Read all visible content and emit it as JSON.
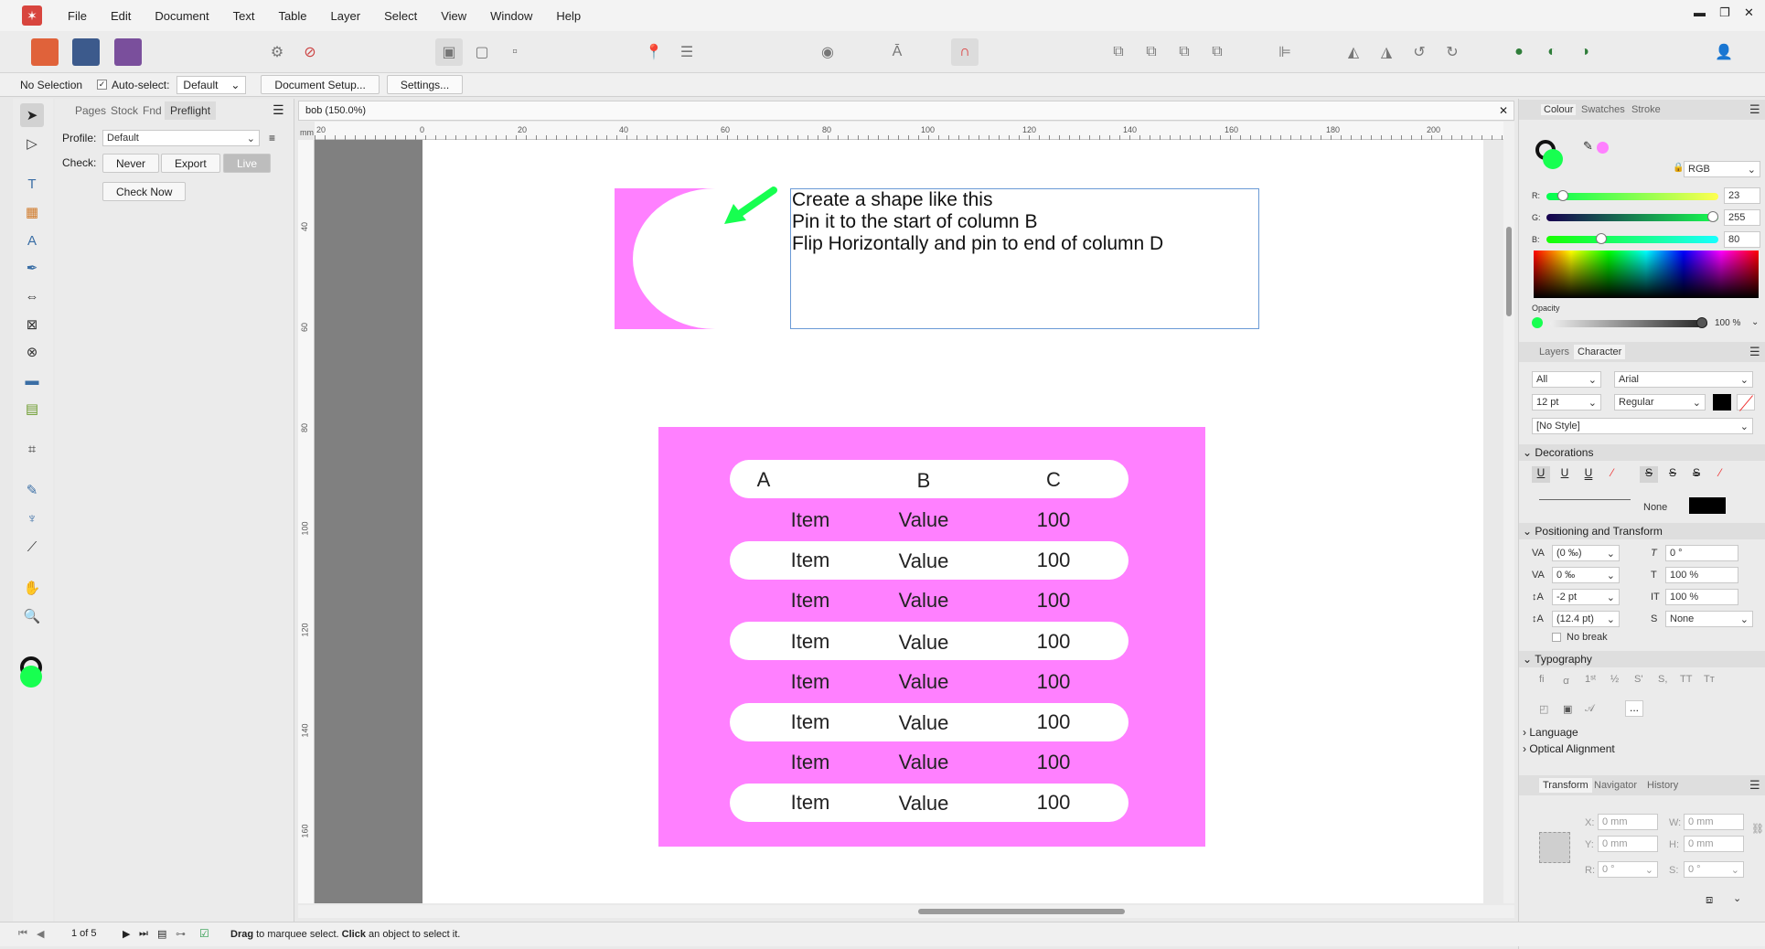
{
  "menu": [
    "File",
    "Edit",
    "Document",
    "Text",
    "Table",
    "Layer",
    "Select",
    "View",
    "Window",
    "Help"
  ],
  "window_controls": {
    "minimize": "▬",
    "restore": "❐",
    "close": "✕"
  },
  "context": {
    "selection": "No Selection",
    "auto_select_label": "Auto-select:",
    "auto_select_value": "Default",
    "document_setup": "Document Setup...",
    "settings": "Settings..."
  },
  "left_panel": {
    "tabs": [
      "Pages",
      "Stock",
      "Fnd",
      "Preflight"
    ],
    "profile_label": "Profile:",
    "profile_value": "Default",
    "check_label": "Check:",
    "check_options": [
      "Never",
      "Export",
      "Live"
    ],
    "check_now": "Check Now"
  },
  "document": {
    "tab_title": "bob (150.0%)",
    "ruler_unit": "mm",
    "ruler_h": [
      "20",
      "0",
      "20",
      "40",
      "60",
      "80",
      "100",
      "120",
      "140",
      "160",
      "180",
      "200"
    ],
    "ruler_v": [
      "40",
      "60",
      "80",
      "100",
      "120",
      "140",
      "160"
    ],
    "instructions": [
      "Create a shape like this",
      "Pin it to the start of  column B",
      "Flip Horizontally and pin to end of column D"
    ],
    "table": {
      "headers": [
        "A",
        "B",
        "C"
      ],
      "rows": [
        [
          "Item",
          "Value",
          "100"
        ],
        [
          "Item",
          "Value",
          "100"
        ],
        [
          "Item",
          "Value",
          "100"
        ],
        [
          "Item",
          "Value",
          "100"
        ],
        [
          "Item",
          "Value",
          "100"
        ],
        [
          "Item",
          "Value",
          "100"
        ],
        [
          "Item",
          "Value",
          "100"
        ],
        [
          "Item",
          "Value",
          "100"
        ]
      ]
    }
  },
  "colour_panel": {
    "tabs": [
      "Colour",
      "Swatches",
      "Stroke"
    ],
    "model": "RGB",
    "r_label": "R:",
    "r": "23",
    "g_label": "G:",
    "g": "255",
    "b_label": "B:",
    "b": "80",
    "opacity_label": "Opacity",
    "opacity": "100 %"
  },
  "character_panel": {
    "tabs": [
      "Layers",
      "Character"
    ],
    "scope": "All",
    "font": "Arial",
    "size": "12 pt",
    "weight": "Regular",
    "style": "[No Style]",
    "decorations_title": "Decorations",
    "decor_none": "None",
    "positioning_title": "Positioning and Transform",
    "pos": {
      "tracking": "(0 ‰)",
      "shear": "0 °",
      "kerning": "0 ‰",
      "vscale": "100 %",
      "baseline": "-2 pt",
      "hscale": "100 %",
      "leading": "(12.4 pt)",
      "script": "None"
    },
    "no_break": "No break",
    "typography_title": "Typography",
    "typo_more": "...",
    "language_title": "Language",
    "optical_title": "Optical Alignment"
  },
  "transform_panel": {
    "tabs": [
      "Transform",
      "Navigator",
      "History"
    ],
    "x_label": "X:",
    "x": "0 mm",
    "w_label": "W:",
    "w": "0 mm",
    "y_label": "Y:",
    "y": "0 mm",
    "h_label": "H:",
    "h": "0 mm",
    "r_label": "R:",
    "r": "0 °",
    "s_label": "S:",
    "s": "0 °"
  },
  "status": {
    "page": "1 of 5",
    "hint_bold1": "Drag",
    "hint_1": " to marquee select. ",
    "hint_bold2": "Click",
    "hint_2": " an object to select it."
  },
  "colors": {
    "accent_green": "#17ff50",
    "pink": "#ff80ff",
    "brand": "#d8453e"
  }
}
